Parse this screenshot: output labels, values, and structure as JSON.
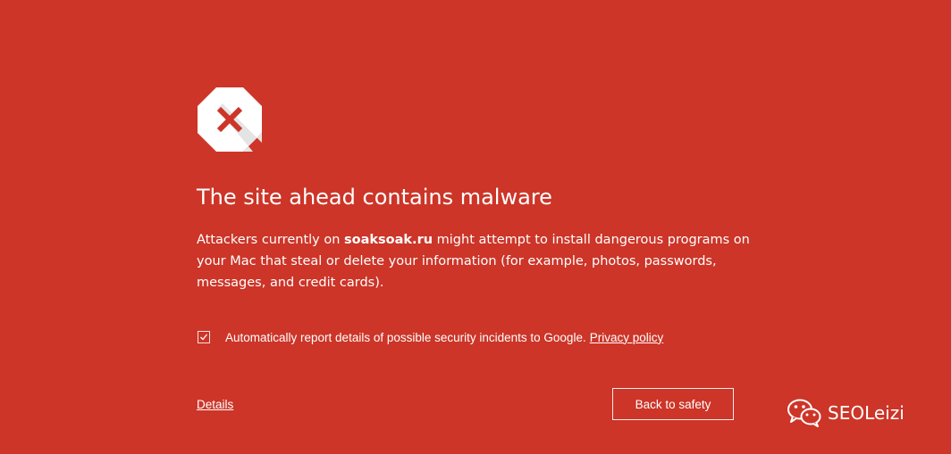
{
  "colors": {
    "background": "#cc3528",
    "foreground": "#ffffff",
    "icon_fill": "#ffffff",
    "icon_shadow": "#e0e0e0",
    "icon_x": "#cc3528"
  },
  "icons": {
    "warning": "stop-octagon-x-icon",
    "checkbox": "checkmark-icon",
    "watermark": "wechat-icon"
  },
  "warning": {
    "title": "The site ahead contains malware",
    "description_prefix": "Attackers currently on ",
    "domain": "soaksoak.ru",
    "description_suffix": " might attempt to install dangerous programs on your Mac that steal or delete your information (for example, photos, passwords, messages, and credit cards)."
  },
  "report": {
    "checked": true,
    "label": "Automatically report details of possible security incidents to Google.",
    "privacy_link": "Privacy policy"
  },
  "actions": {
    "details_label": "Details",
    "back_label": "Back to safety"
  },
  "watermark": {
    "text": "SEOLeizi"
  }
}
